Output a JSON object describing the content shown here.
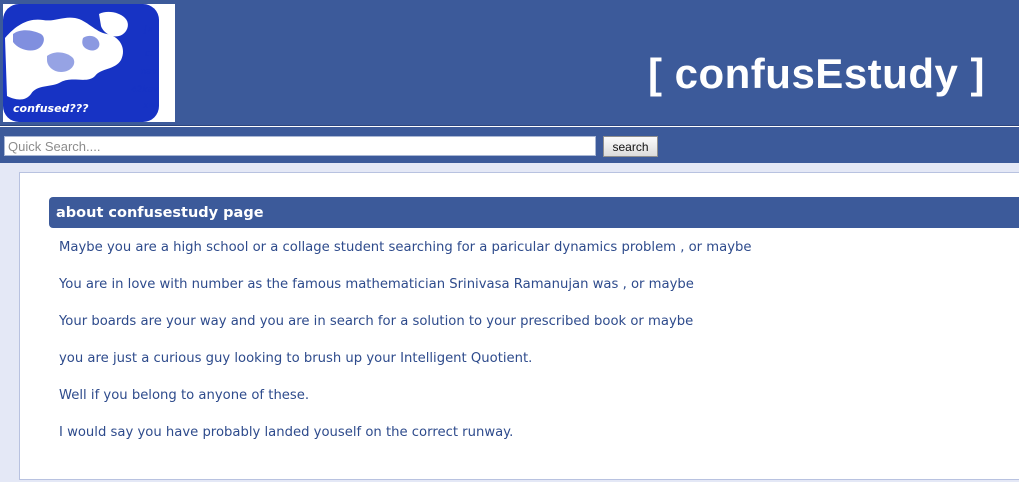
{
  "header": {
    "logo_caption": "confused???",
    "site_title": "[ confusEstudy ]"
  },
  "search": {
    "placeholder": "Quick Search....",
    "value": "",
    "button_label": "search"
  },
  "about": {
    "heading": "about confusestudy page",
    "paragraphs": [
      "Maybe you are a high school or a collage student searching for a paricular dynamics problem , or maybe",
      "You are in love with number as the famous mathematician Srinivasa Ramanujan was , or maybe",
      "Your boards are your way and you are in search for a solution to your prescribed book or maybe",
      "you are just a curious guy looking to brush up your Intelligent Quotient.",
      "Well if you belong to anyone of these.",
      "I would say you have probably landed youself on the correct runway."
    ]
  },
  "colors": {
    "header_bg": "#3c5a9a",
    "text_blue": "#2e4b8c",
    "content_bg": "#e4e8f6"
  },
  "icons": {
    "logo": "confused-student-logo-image"
  }
}
